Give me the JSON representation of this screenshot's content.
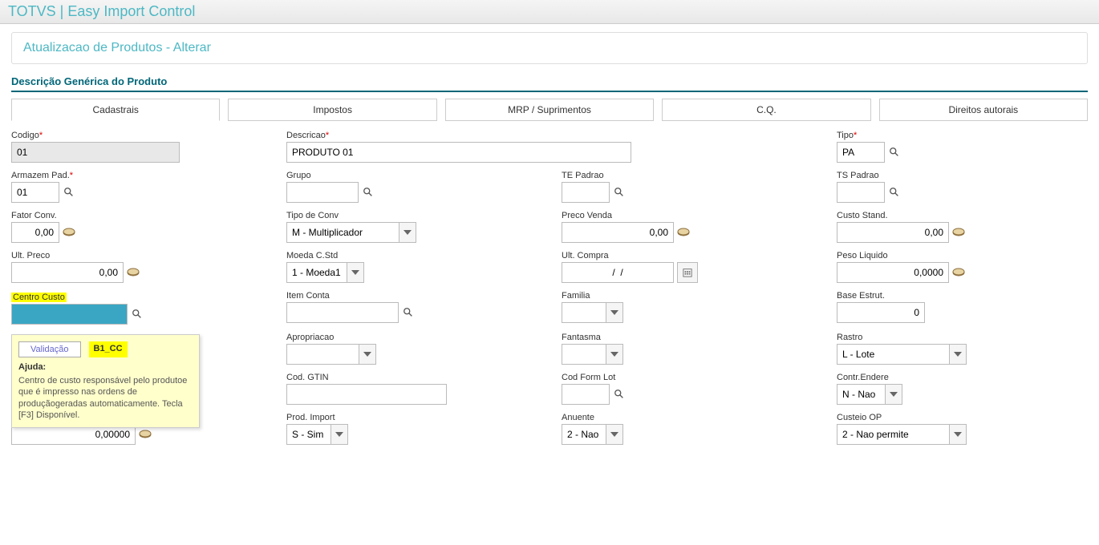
{
  "app_title": "TOTVS | Easy Import Control",
  "page_subtitle": "Atualizacao de Produtos - Alterar",
  "section_title": "Descrição Genérica do Produto",
  "tabs": [
    {
      "label": "Cadastrais"
    },
    {
      "label": "Impostos"
    },
    {
      "label": "MRP / Suprimentos"
    },
    {
      "label": "C.Q."
    },
    {
      "label": "Direitos autorais"
    }
  ],
  "fields": {
    "codigo": {
      "label": "Codigo",
      "value": "01",
      "required": true
    },
    "descricao": {
      "label": "Descricao",
      "value": "PRODUTO 01",
      "required": true
    },
    "tipo": {
      "label": "Tipo",
      "value": "PA",
      "required": true
    },
    "armazem": {
      "label": "Armazem Pad.",
      "value": "01",
      "required": true
    },
    "grupo": {
      "label": "Grupo",
      "value": ""
    },
    "te_padrao": {
      "label": "TE Padrao",
      "value": ""
    },
    "ts_padrao": {
      "label": "TS Padrao",
      "value": ""
    },
    "fator_conv": {
      "label": "Fator Conv.",
      "value": "0,00"
    },
    "tipo_conv": {
      "label": "Tipo de Conv",
      "value": "M - Multiplicador"
    },
    "preco_venda": {
      "label": "Preco Venda",
      "value": "0,00"
    },
    "custo_stand": {
      "label": "Custo Stand.",
      "value": "0,00"
    },
    "ult_preco": {
      "label": "Ult. Preco",
      "value": "0,00"
    },
    "moeda_cstd": {
      "label": "Moeda C.Std",
      "value": "1 - Moeda1"
    },
    "ult_compra": {
      "label": "Ult. Compra",
      "value": "  /  /  "
    },
    "peso_liquido": {
      "label": "Peso Liquido",
      "value": "0,0000"
    },
    "centro_custo": {
      "label": "Centro Custo",
      "value": ""
    },
    "item_conta": {
      "label": "Item Conta",
      "value": ""
    },
    "familia": {
      "label": "Familia",
      "value": ""
    },
    "base_estrut": {
      "label": "Base Estrut.",
      "value": "0"
    },
    "apropriacao": {
      "label": "Apropriacao",
      "value": ""
    },
    "fantasma": {
      "label": "Fantasma",
      "value": ""
    },
    "rastro": {
      "label": "Rastro",
      "value": "L - Lote"
    },
    "cod_gtin": {
      "label": "Cod. GTIN",
      "value": ""
    },
    "cod_form_lot": {
      "label": "Cod Form Lot",
      "value": ""
    },
    "contr_endere": {
      "label": "Contr.Endere",
      "value": "N - Nao"
    },
    "prod_import": {
      "label": "Prod. Import",
      "value": "S - Sim"
    },
    "anuente": {
      "label": "Anuente",
      "value": "2 - Nao"
    },
    "custeio_op": {
      "label": "Custeio OP",
      "value": "2 - Nao permite"
    },
    "extra_num": {
      "value": "0,00000"
    }
  },
  "tooltip": {
    "button_label": "Validação",
    "field_code": "B1_CC",
    "help_label": "Ajuda:",
    "help_text": "Centro de custo responsável pelo produtoe que é impresso nas ordens de produçãogeradas automaticamente. Tecla [F3] Disponível."
  }
}
